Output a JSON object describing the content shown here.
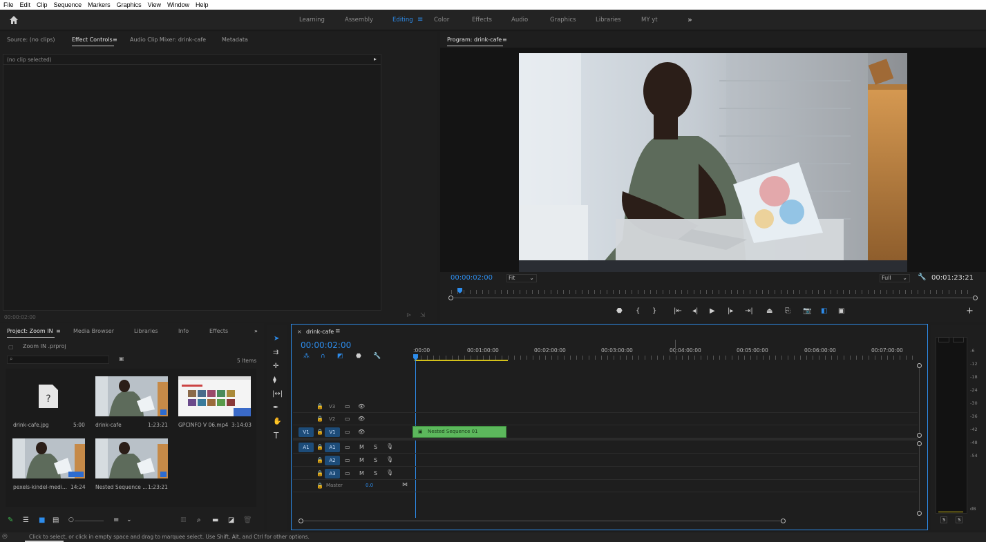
{
  "menu": [
    "File",
    "Edit",
    "Clip",
    "Sequence",
    "Markers",
    "Graphics",
    "View",
    "Window",
    "Help"
  ],
  "workspaces": [
    "Learning",
    "Assembly",
    "Editing",
    "Color",
    "Effects",
    "Audio",
    "Graphics",
    "Libraries",
    "MY yt"
  ],
  "active_workspace": "Editing",
  "source_panel": {
    "tabs": [
      "Source: (no clips)",
      "Effect Controls",
      "Audio Clip Mixer: drink-cafe",
      "Metadata"
    ],
    "active_tab": "Effect Controls",
    "no_clip": "(no clip selected)",
    "timecode": "00:00:02:00"
  },
  "program": {
    "title": "Program: drink-cafe",
    "timecode": "00:00:02:00",
    "fit": "Fit",
    "quality": "Full",
    "duration": "00:01:23:21"
  },
  "project": {
    "tabs": [
      "Project: Zoom IN",
      "Media Browser",
      "Libraries",
      "Info",
      "Effects"
    ],
    "file": "Zoom IN .prproj",
    "items_count": "5 Items",
    "items": [
      {
        "name": "drink-cafe.jpg",
        "duration": "5:00"
      },
      {
        "name": "drink-cafe",
        "duration": "1:23:21"
      },
      {
        "name": "GPCINFO V 06.mp4",
        "duration": "3:14:03"
      },
      {
        "name": "pexels-kindel-medi...",
        "duration": "14:24"
      },
      {
        "name": "Nested Sequence ...",
        "duration": "1:23:21"
      }
    ]
  },
  "timeline": {
    "title": "drink-cafe",
    "timecode": "00:00:02:00",
    "ruler": [
      ":00:00",
      "00:01:00:00",
      "00:02:00:00",
      "00:03:00:00",
      "00:04:00:00",
      "00:05:00:00",
      "00:06:00:00",
      "00:07:00:00"
    ],
    "video_tracks": [
      "V3",
      "V2",
      "V1"
    ],
    "audio_tracks": [
      "A1",
      "A2",
      "A3"
    ],
    "source_v": "V1",
    "source_a": "A1",
    "master": "Master",
    "master_value": "0.0",
    "clip": "Nested Sequence 01",
    "clip_color": "#5cb85c"
  },
  "meters": [
    "-6",
    "-12",
    "-18",
    "-24",
    "-30",
    "-36",
    "-42",
    "-48",
    "-54",
    "dB"
  ],
  "meter_solo": [
    "S",
    "S"
  ],
  "status": "Click to select, or click in empty space and drag to marquee select. Use Shift, Alt, and Ctrl for other options.",
  "accent": "#2d8ceb"
}
